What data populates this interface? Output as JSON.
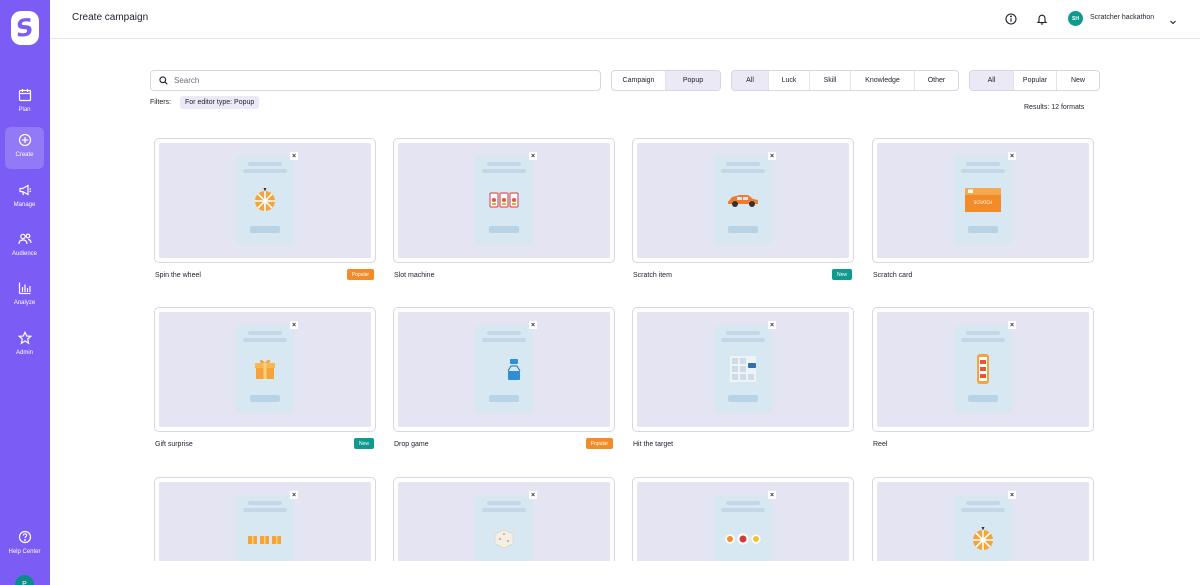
{
  "app": {
    "page_title": "Create campaign",
    "user_initials": "SH",
    "user_name": "Scratcher hackathon",
    "bottom_avatar_initial": "P"
  },
  "sidebar": {
    "items": [
      {
        "label": "Plan",
        "icon": "calendar-icon"
      },
      {
        "label": "Create",
        "icon": "plus-circle-icon"
      },
      {
        "label": "Manage",
        "icon": "megaphone-icon"
      },
      {
        "label": "Audience",
        "icon": "users-icon"
      },
      {
        "label": "Analyze",
        "icon": "bar-chart-icon"
      },
      {
        "label": "Admin",
        "icon": "star-icon"
      }
    ],
    "help": {
      "label": "Help Center",
      "icon": "help-icon"
    }
  },
  "toolbar": {
    "search_placeholder": "Search",
    "editor_types": [
      {
        "label": "Campaign"
      },
      {
        "label": "Popup",
        "selected": true
      }
    ],
    "categories": [
      {
        "label": "All",
        "selected": true
      },
      {
        "label": "Luck"
      },
      {
        "label": "Skill"
      },
      {
        "label": "Knowledge"
      },
      {
        "label": "Other"
      }
    ],
    "sort": [
      {
        "label": "All",
        "selected": true
      },
      {
        "label": "Popular"
      },
      {
        "label": "New"
      }
    ],
    "filters_label": "Filters:",
    "filter_chip": "For editor type: Popup",
    "results": "Results: 12 formats"
  },
  "formats": [
    {
      "name": "Spin the wheel",
      "badge": "Popular",
      "art": "wheel"
    },
    {
      "name": "Slot machine",
      "badge": "",
      "art": "slot"
    },
    {
      "name": "Scratch item",
      "badge": "New",
      "art": "car"
    },
    {
      "name": "Scratch card",
      "badge": "",
      "art": "scratch"
    },
    {
      "name": "Gift surprise",
      "badge": "New",
      "art": "gift"
    },
    {
      "name": "Drop game",
      "badge": "Popular",
      "art": "drop"
    },
    {
      "name": "Hit the target",
      "badge": "",
      "art": "target"
    },
    {
      "name": "Reel",
      "badge": "",
      "art": "reel"
    },
    {
      "name": "",
      "badge": "",
      "art": "gifts"
    },
    {
      "name": "",
      "badge": "",
      "art": "dice"
    },
    {
      "name": "",
      "badge": "",
      "art": "fruits"
    },
    {
      "name": "",
      "badge": "",
      "art": "wheel"
    }
  ],
  "colors": {
    "sidebar": "#7b5cf5",
    "popular_badge": "#f28c28",
    "new_badge": "#0e9a8e",
    "thumb_bg": "#e5e4f2"
  }
}
